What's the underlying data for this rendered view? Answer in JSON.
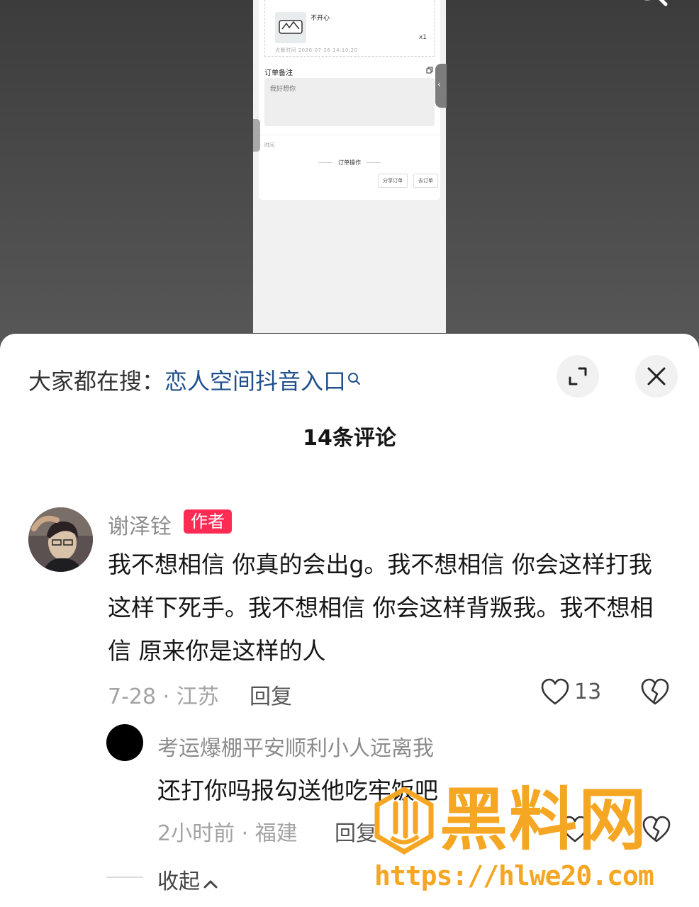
{
  "preview": {
    "goods_name": "不开心",
    "goods_qty": "x1",
    "goods_time": "点餐时间  2026-07-26 14:10:20",
    "remark_title": "订单备注",
    "remark_text": "我好想你",
    "tiny_label": "时间",
    "ops_title": "订单操作",
    "op_buttons": [
      "分享订单",
      "去订单"
    ]
  },
  "sheet": {
    "search_prefix": "大家都在搜：",
    "search_keyword": "恋人空间抖音入口",
    "comment_count": "14条评论"
  },
  "comment": {
    "username": "谢泽铨",
    "badge": "作者",
    "text": "我不想相信 你真的会出g。我不想相信 你会这样打我 这样下死手。我不想相信 你会这样背叛我。我不想相信 原来你是这样的人",
    "date_location": "7-28 · 江苏",
    "reply_label": "回复",
    "like_count": "13"
  },
  "reply": {
    "username": "考运爆棚平安顺利小人远离我",
    "text": "还打你吗报勾送他吃牢饭吧",
    "date_location": "2小时前 · 福建",
    "reply_label": "回复"
  },
  "collapse_label": "收起",
  "watermark": {
    "brand": "黑料网",
    "url": "https://hlwe20.com"
  },
  "colors": {
    "author_badge": "#fe2c55",
    "search_keyword": "#1f4f8c",
    "watermark": "#f5a623"
  }
}
